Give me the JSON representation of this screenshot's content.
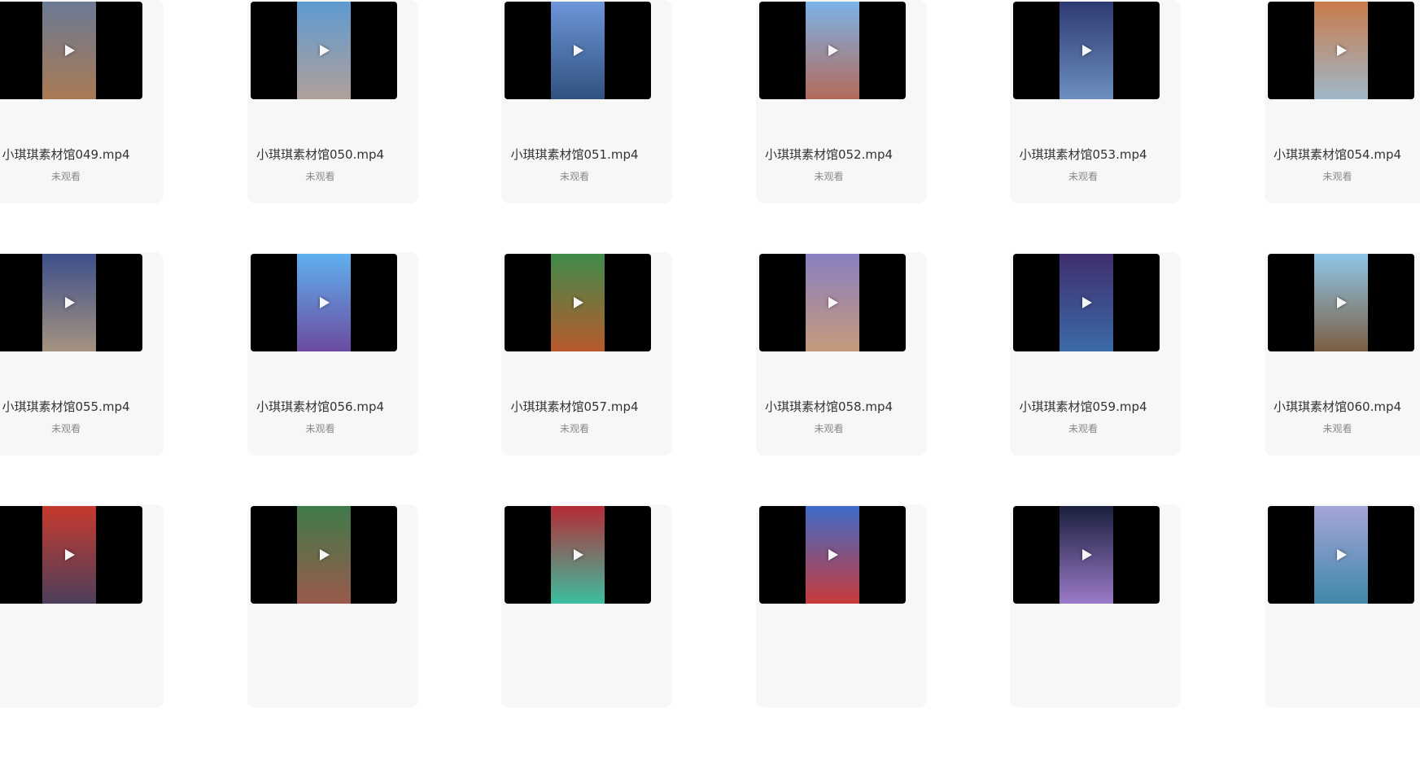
{
  "videos": [
    {
      "name": "小琪琪素材馆049.mp4",
      "status": "未观看",
      "icon": "play-icon",
      "colors": [
        "#6b7a95",
        "#a97a54"
      ]
    },
    {
      "name": "小琪琪素材馆050.mp4",
      "status": "未观看",
      "icon": "play-icon",
      "colors": [
        "#5e9ad1",
        "#b0a09a"
      ]
    },
    {
      "name": "小琪琪素材馆051.mp4",
      "status": "未观看",
      "icon": "play-icon",
      "colors": [
        "#6d95d9",
        "#30527f"
      ]
    },
    {
      "name": "小琪琪素材馆052.mp4",
      "status": "未观看",
      "icon": "play-icon",
      "colors": [
        "#7bb3e8",
        "#b46a5a"
      ]
    },
    {
      "name": "小琪琪素材馆053.mp4",
      "status": "未观看",
      "icon": "play-icon",
      "colors": [
        "#2e3a72",
        "#6c8fbf"
      ]
    },
    {
      "name": "小琪琪素材馆054.mp4",
      "status": "未观看",
      "icon": "play-icon",
      "colors": [
        "#c97b4b",
        "#9fb7c9"
      ]
    },
    {
      "name": "小琪琪素材馆055.mp4",
      "status": "未观看",
      "icon": "play-icon",
      "colors": [
        "#3d4f8a",
        "#a59380"
      ]
    },
    {
      "name": "小琪琪素材馆056.mp4",
      "status": "未观看",
      "icon": "play-icon",
      "colors": [
        "#5fb0ee",
        "#6b4ba0"
      ]
    },
    {
      "name": "小琪琪素材馆057.mp4",
      "status": "未观看",
      "icon": "play-icon",
      "colors": [
        "#3f8b4a",
        "#b8592c"
      ]
    },
    {
      "name": "小琪琪素材馆058.mp4",
      "status": "未观看",
      "icon": "play-icon",
      "colors": [
        "#8a7fc2",
        "#c69a7a"
      ]
    },
    {
      "name": "小琪琪素材馆059.mp4",
      "status": "未观看",
      "icon": "play-icon",
      "colors": [
        "#402e6d",
        "#3b6aa8"
      ]
    },
    {
      "name": "小琪琪素材馆060.mp4",
      "status": "未观看",
      "icon": "play-icon",
      "colors": [
        "#8fc6e8",
        "#7b5e43"
      ]
    },
    {
      "name": "",
      "status": "",
      "icon": "play-icon",
      "colors": [
        "#c63a2e",
        "#4c3f5b"
      ]
    },
    {
      "name": "",
      "status": "",
      "icon": "play-icon",
      "colors": [
        "#3f7a4a",
        "#9a5a4b"
      ]
    },
    {
      "name": "",
      "status": "",
      "icon": "play-icon",
      "colors": [
        "#b52b35",
        "#3bbfa0"
      ]
    },
    {
      "name": "",
      "status": "",
      "icon": "play-icon",
      "colors": [
        "#3f6cc9",
        "#c83a3a"
      ]
    },
    {
      "name": "",
      "status": "",
      "icon": "play-icon",
      "colors": [
        "#1a1f3d",
        "#9b7ac8"
      ]
    },
    {
      "name": "",
      "status": "",
      "icon": "play-icon",
      "colors": [
        "#a5a5d8",
        "#3f88a8"
      ]
    }
  ]
}
